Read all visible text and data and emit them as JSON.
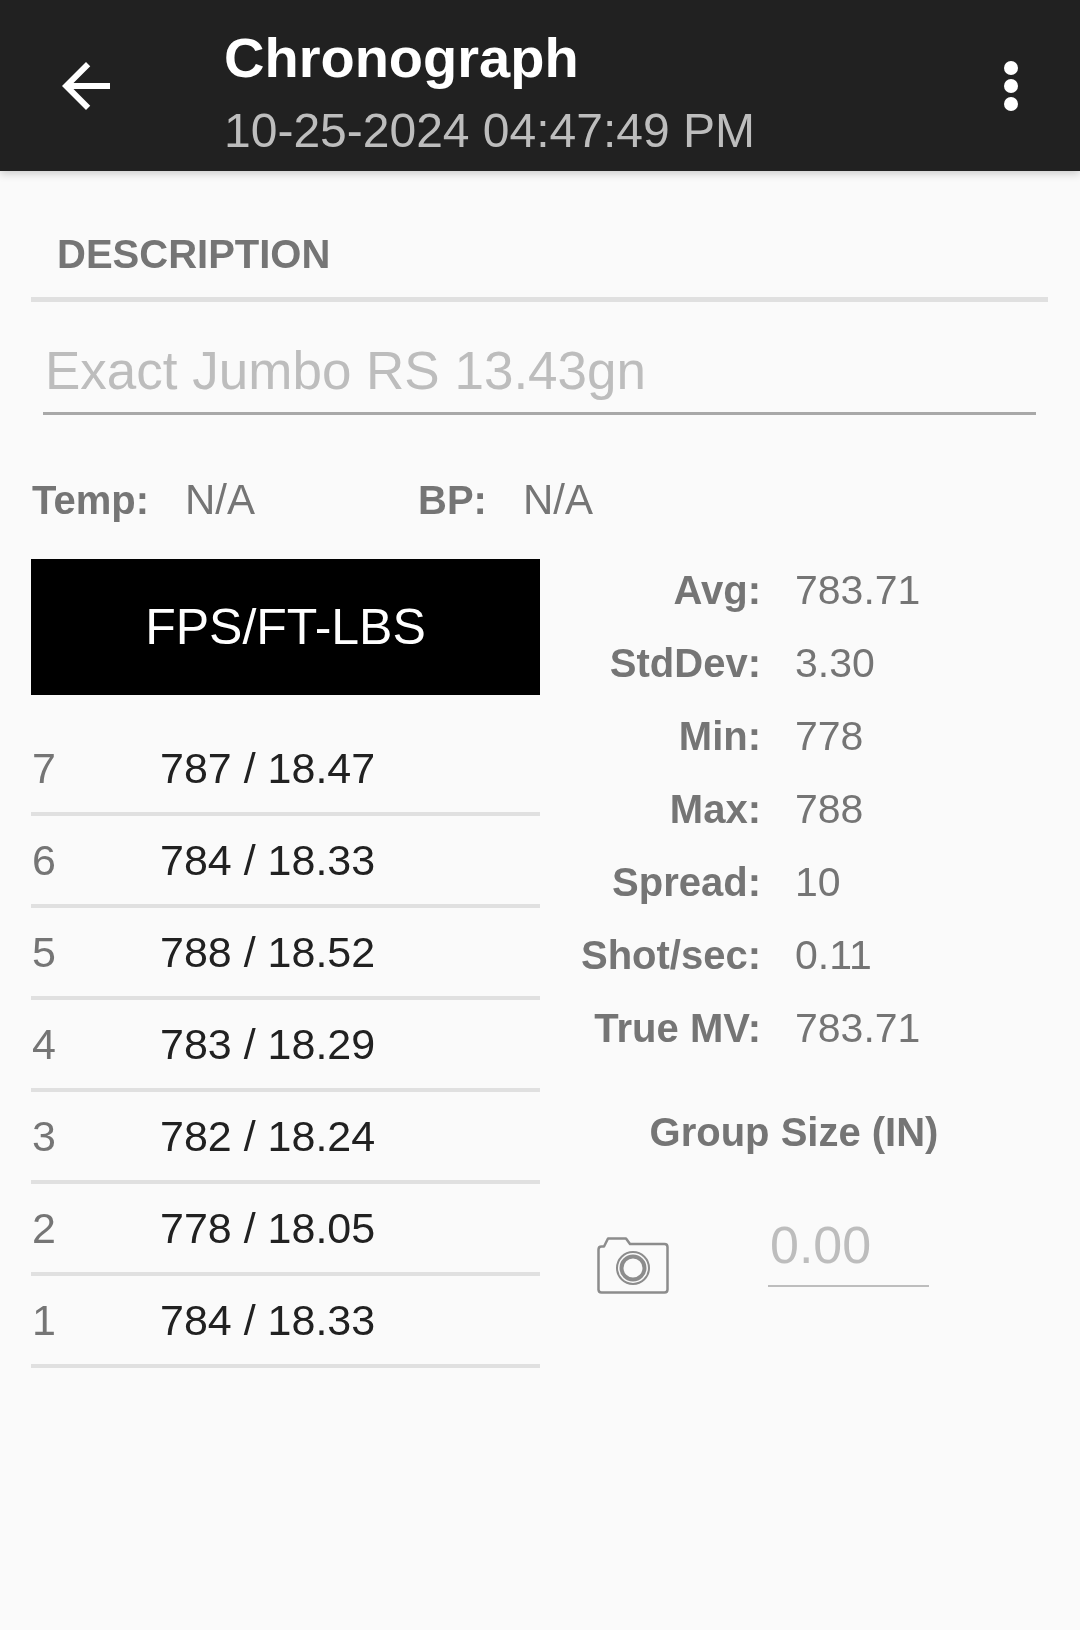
{
  "app_bar": {
    "title": "Chronograph",
    "subtitle": "10-25-2024 04:47:49 PM"
  },
  "description": {
    "label": "DESCRIPTION",
    "placeholder": "Exact Jumbo RS 13.43gn"
  },
  "conditions": [
    {
      "label": "Temp:",
      "value": "N/A"
    },
    {
      "label": "BP:",
      "value": "N/A"
    }
  ],
  "shots": {
    "header": "FPS/FT-LBS",
    "rows": [
      {
        "number": "7",
        "reading": "787 / 18.47"
      },
      {
        "number": "6",
        "reading": "784 / 18.33"
      },
      {
        "number": "5",
        "reading": "788 / 18.52"
      },
      {
        "number": "4",
        "reading": "783 / 18.29"
      },
      {
        "number": "3",
        "reading": "782 / 18.24"
      },
      {
        "number": "2",
        "reading": "778 / 18.05"
      },
      {
        "number": "1",
        "reading": "784 / 18.33"
      }
    ]
  },
  "stats": [
    {
      "label": "Avg:",
      "value": "783.71"
    },
    {
      "label": "StdDev:",
      "value": "3.30"
    },
    {
      "label": "Min:",
      "value": "778"
    },
    {
      "label": "Max:",
      "value": "788"
    },
    {
      "label": "Spread:",
      "value": "10"
    },
    {
      "label": "Shot/sec:",
      "value": "0.11"
    },
    {
      "label": "True MV:",
      "value": "783.71"
    }
  ],
  "group_size": {
    "label": "Group Size (IN)",
    "placeholder": "0.00"
  }
}
